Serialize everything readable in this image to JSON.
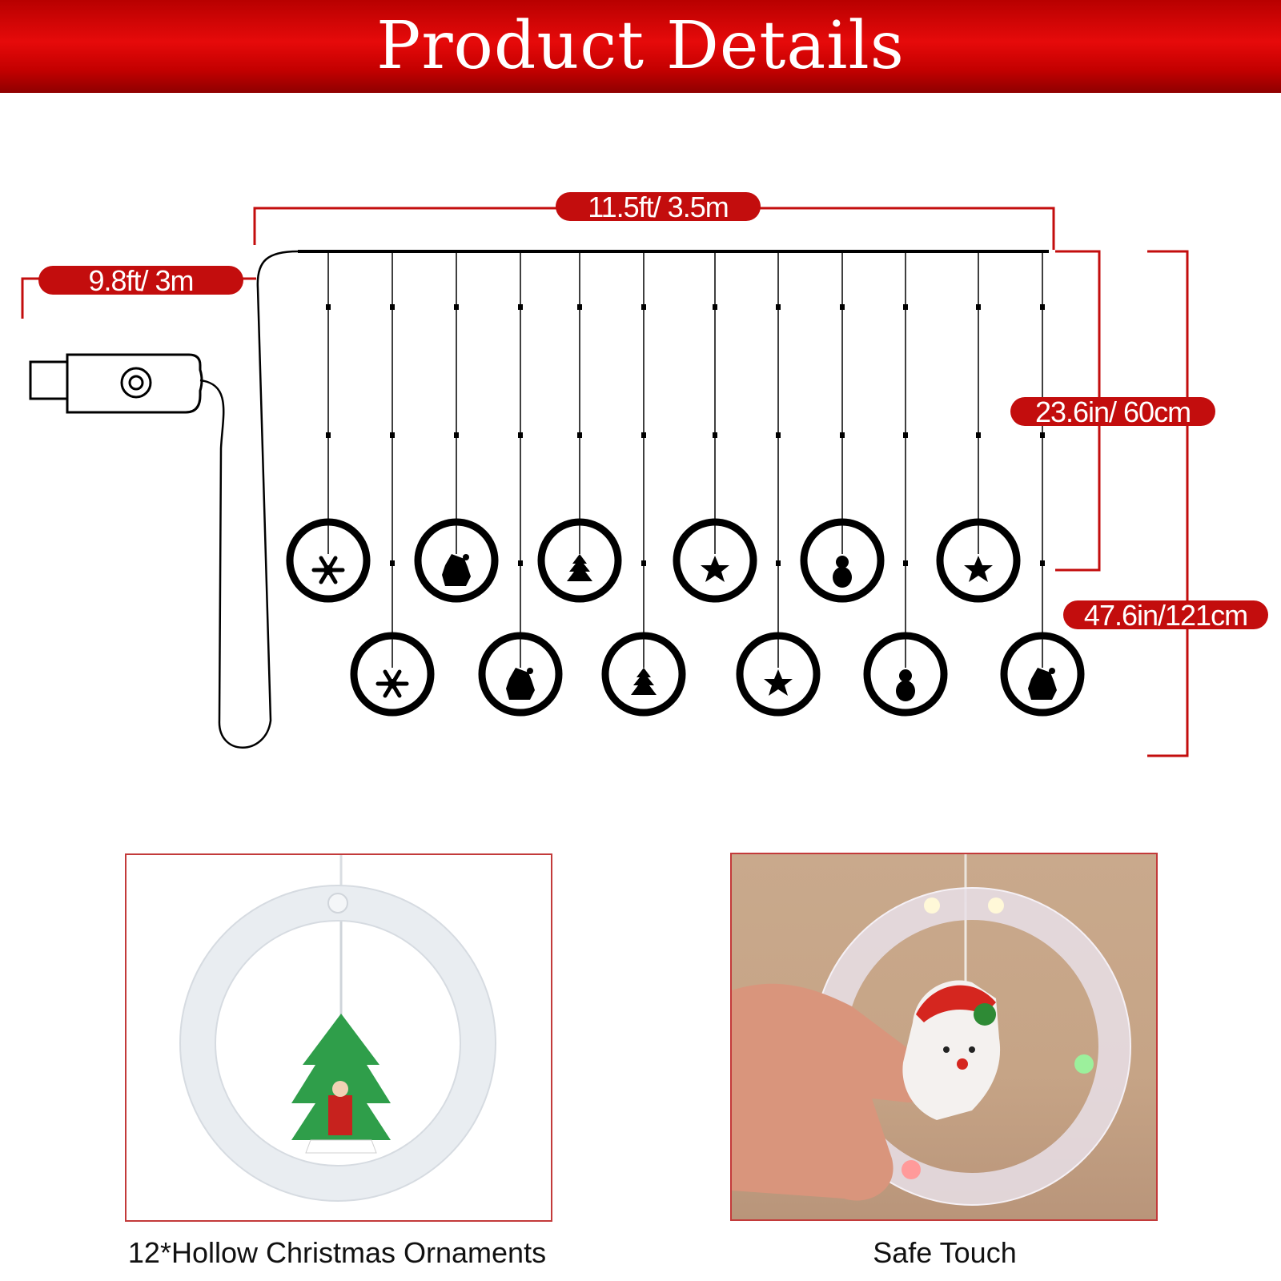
{
  "header": {
    "title": "Product Details"
  },
  "dimensions": {
    "curtain_width": "11.5ft/ 3.5m",
    "lead_cable": "9.8ft/ 3m",
    "short_drop": "23.6in/ 60cm",
    "long_drop": "47.6in/121cm"
  },
  "ornaments": {
    "upper_row": [
      "snowflake-icon",
      "santa-icon",
      "tree-icon",
      "star-icon",
      "snowman-icon",
      "star-icon"
    ],
    "lower_row": [
      "snowflake-icon",
      "santa-icon",
      "tree-icon",
      "star-icon",
      "snowman-icon",
      "santa-icon"
    ]
  },
  "photos": {
    "left_caption": "12*Hollow Christmas Ornaments",
    "right_caption": "Safe Touch"
  },
  "colors": {
    "accent": "#c30d0d",
    "banner": "#d40000",
    "line": "#000000"
  }
}
